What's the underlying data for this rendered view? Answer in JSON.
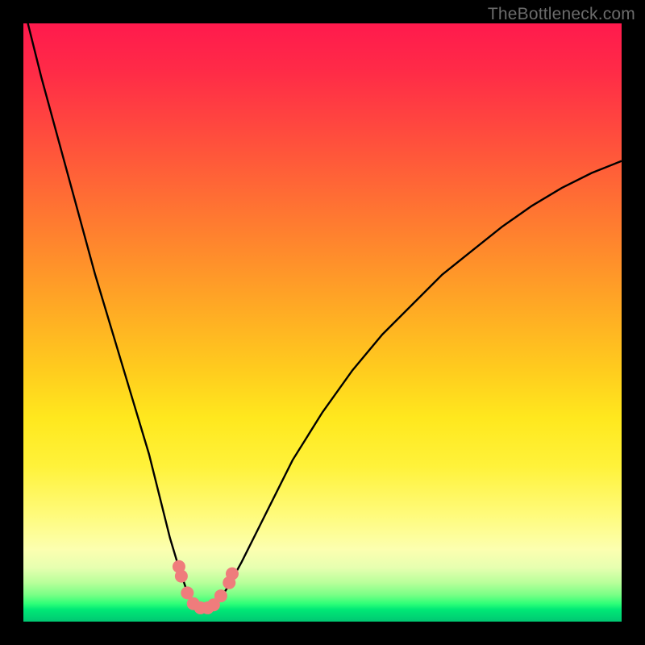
{
  "watermark": {
    "text": "TheBottleneck.com"
  },
  "chart_data": {
    "type": "line",
    "title": "",
    "xlabel": "",
    "ylabel": "",
    "xlim": [
      0,
      100
    ],
    "ylim": [
      0,
      100
    ],
    "series": [
      {
        "name": "bottleneck-curve",
        "x": [
          0,
          3,
          6,
          9,
          12,
          15,
          18,
          21,
          23,
          24.5,
          26,
          27.2,
          28.3,
          29.3,
          30.2,
          31.2,
          32.5,
          34.2,
          36.5,
          40,
          45,
          50,
          55,
          60,
          65,
          70,
          75,
          80,
          85,
          90,
          95,
          100
        ],
        "y": [
          103,
          91,
          80,
          69,
          58,
          48,
          38,
          28,
          20,
          14,
          9,
          5.5,
          3.2,
          2.2,
          2.0,
          2.2,
          3.3,
          5.8,
          10,
          17,
          27,
          35,
          42,
          48,
          53,
          58,
          62,
          66,
          69.5,
          72.5,
          75,
          77
        ]
      }
    ],
    "markers": {
      "name": "highlight-dots",
      "color": "#ef7c7c",
      "points": [
        {
          "x": 26.0,
          "y": 9.2
        },
        {
          "x": 26.4,
          "y": 7.6
        },
        {
          "x": 27.4,
          "y": 4.8
        },
        {
          "x": 28.4,
          "y": 3.0
        },
        {
          "x": 29.6,
          "y": 2.3
        },
        {
          "x": 30.8,
          "y": 2.3
        },
        {
          "x": 31.8,
          "y": 2.8
        },
        {
          "x": 33.0,
          "y": 4.3
        },
        {
          "x": 34.4,
          "y": 6.5
        },
        {
          "x": 34.9,
          "y": 8.0
        }
      ]
    },
    "background": {
      "type": "vertical-gradient",
      "stops": [
        {
          "pos": 0.0,
          "color": "#ff1a4d"
        },
        {
          "pos": 0.5,
          "color": "#ffcc1e"
        },
        {
          "pos": 0.82,
          "color": "#fffb7a"
        },
        {
          "pos": 0.95,
          "color": "#7aff86"
        },
        {
          "pos": 1.0,
          "color": "#00c772"
        }
      ]
    }
  }
}
